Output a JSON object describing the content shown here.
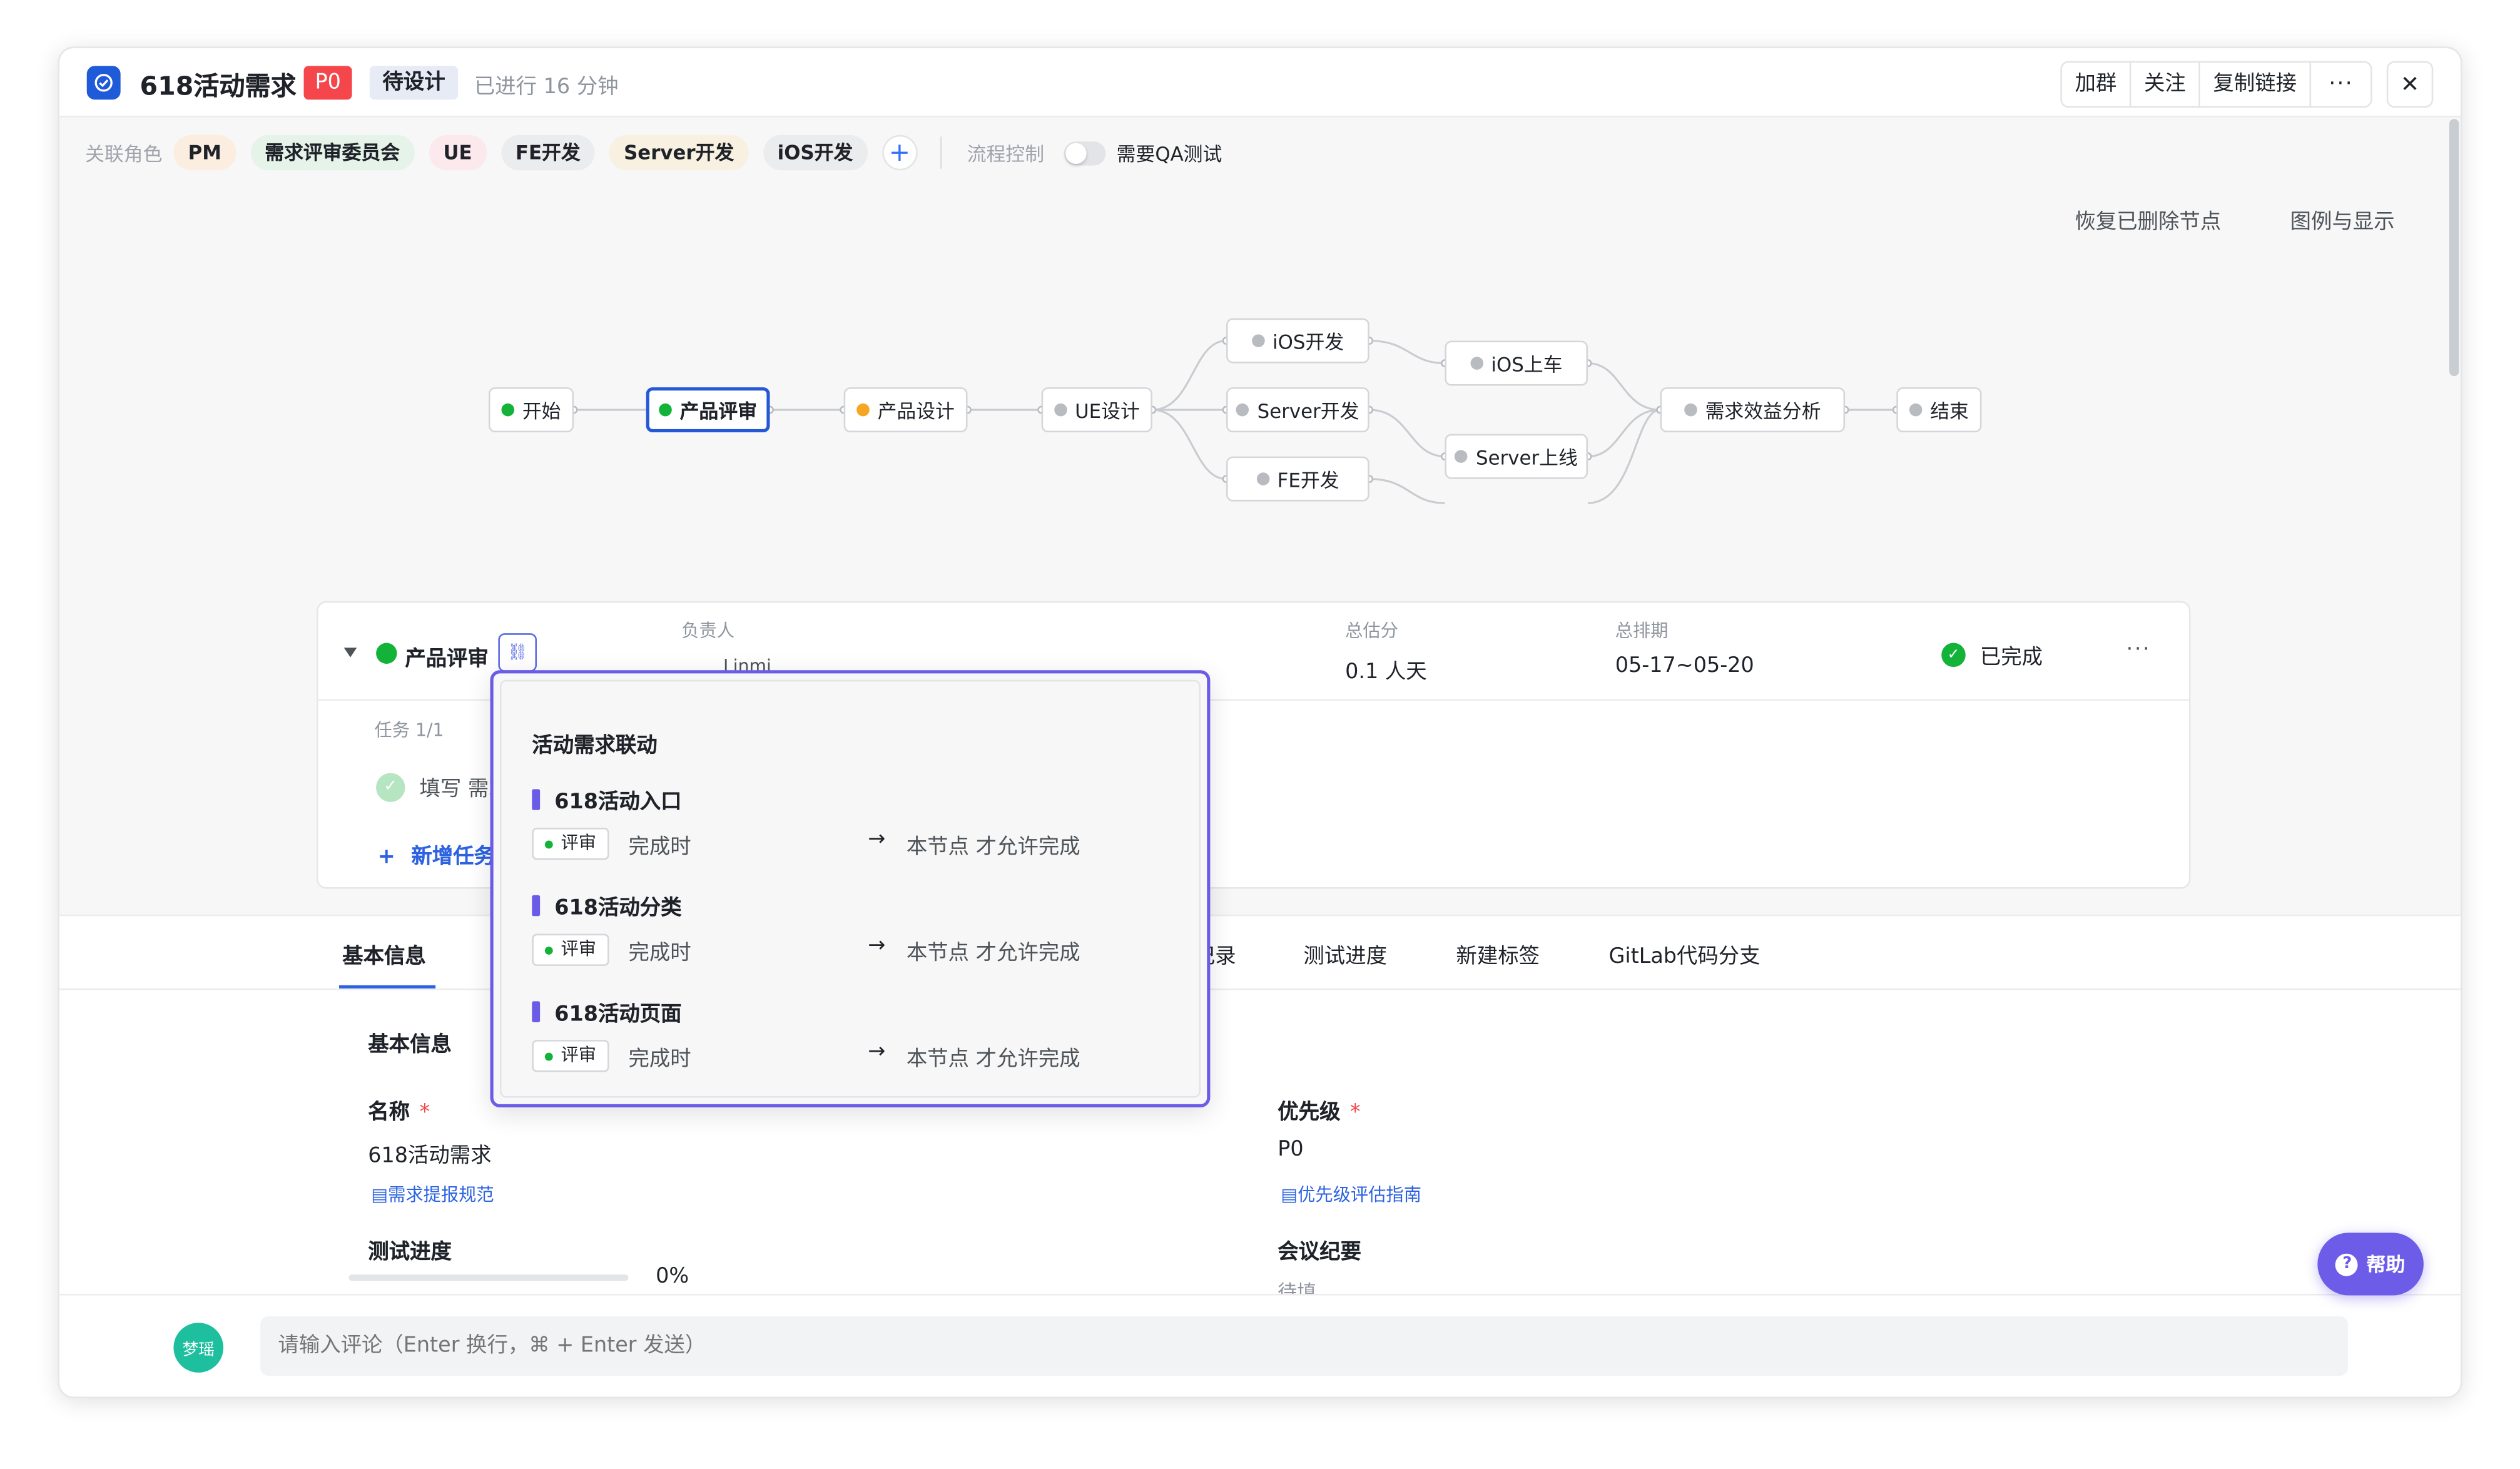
{
  "header": {
    "title": "618活动需求",
    "priority_badge": "P0",
    "state_badge": "待设计",
    "elapsed": "已进行 16 分钟",
    "actions": [
      "加群",
      "关注",
      "复制链接",
      "···"
    ],
    "close": "✕"
  },
  "roles": {
    "label": "关联角色",
    "items": [
      {
        "label": "PM",
        "color": "#fbeee0"
      },
      {
        "label": "需求评审委员会",
        "color": "#e5f3e9"
      },
      {
        "label": "UE",
        "color": "#fbe9ee"
      },
      {
        "label": "FE开发",
        "color": "#ebecee"
      },
      {
        "label": "Server开发",
        "color": "#f8f0e0"
      },
      {
        "label": "iOS开发",
        "color": "#ebecee"
      }
    ],
    "add": "+",
    "flow_control_label": "流程控制",
    "qa_toggle_label": "需要QA测试"
  },
  "diagram_links": {
    "restore": "恢复已删除节点",
    "legend": "图例与显示"
  },
  "flow": {
    "nodes": [
      {
        "label": "开始",
        "status_color": "#13b33a"
      },
      {
        "label": "产品评审",
        "status_color": "#13b33a"
      },
      {
        "label": "产品设计",
        "status_color": "#f5a623"
      },
      {
        "label": "UE设计",
        "status_color": "#b8bbc0"
      },
      {
        "label": "iOS开发",
        "status_color": "#b8bbc0"
      },
      {
        "label": "Server开发",
        "status_color": "#b8bbc0"
      },
      {
        "label": "FE开发",
        "status_color": "#b8bbc0"
      },
      {
        "label": "iOS上车",
        "status_color": "#b8bbc0"
      },
      {
        "label": "Server上线",
        "status_color": "#b8bbc0"
      },
      {
        "label": "需求效益分析",
        "status_color": "#b8bbc0"
      },
      {
        "label": "结束",
        "status_color": "#b8bbc0"
      }
    ]
  },
  "phase": {
    "name": "产品评审",
    "owner_label": "负责人",
    "owner": "Linmi",
    "estimate_label": "总估分",
    "estimate": "0.1 人天",
    "schedule_label": "总排期",
    "schedule": "05-17~05-20",
    "status": "已完成",
    "more": "···",
    "task_count": "任务  1/1",
    "task": "填写 需求",
    "add_task": "新增任务"
  },
  "tabs": {
    "items": [
      "基本信息",
      "记录",
      "测试进度",
      "新建标签",
      "GitLab代码分支"
    ]
  },
  "basic": {
    "section_title": "基本信息",
    "name_label": "名称",
    "name_value": "618活动需求",
    "name_link": "需求提报规范",
    "priority_label": "优先级",
    "priority_value": "P0",
    "priority_link": "优先级评估指南",
    "test_progress_label": "测试进度",
    "test_progress_value": "0%",
    "meeting_label": "会议纪要",
    "meeting_value": "待填",
    "required_mark": "*"
  },
  "help": {
    "label": "帮助",
    "icon": "?"
  },
  "comment": {
    "avatar": "梦瑶",
    "placeholder": "请输入评论（Enter 换行，⌘ + Enter 发送）"
  },
  "popover": {
    "title": "活动需求联动",
    "items": [
      {
        "title": "618活动入口",
        "tag": "评审",
        "when": "完成时",
        "arrow": "→",
        "result": "本节点 才允许完成"
      },
      {
        "title": "618活动分类",
        "tag": "评审",
        "when": "完成时",
        "arrow": "→",
        "result": "本节点 才允许完成"
      },
      {
        "title": "618活动页面",
        "tag": "评审",
        "when": "完成时",
        "arrow": "→",
        "result": "本节点 才允许完成"
      }
    ]
  }
}
